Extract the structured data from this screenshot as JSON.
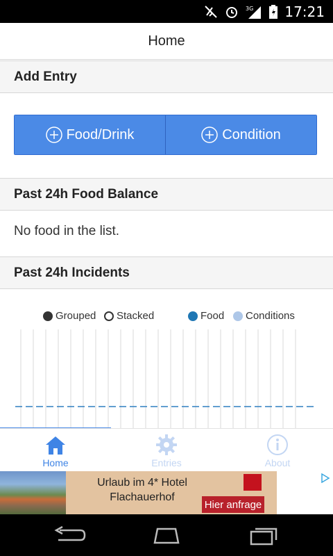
{
  "status_bar": {
    "time": "17:21",
    "network": "3G"
  },
  "header": {
    "title": "Home"
  },
  "sections": {
    "add_entry": {
      "title": "Add Entry"
    },
    "food_balance": {
      "title": "Past 24h Food Balance",
      "empty_text": "No food in the list."
    },
    "incidents": {
      "title": "Past 24h Incidents"
    }
  },
  "buttons": {
    "food_drink": "Food/Drink",
    "condition": "Condition"
  },
  "chart_legend": {
    "grouped": "Grouped",
    "stacked": "Stacked",
    "food": "Food",
    "conditions": "Conditions",
    "colors": {
      "grouped": "#333333",
      "food": "#1f77b4",
      "conditions": "#aec7e8"
    }
  },
  "chart_data": {
    "type": "bar",
    "mode": "grouped",
    "series": [
      {
        "name": "Food",
        "values": []
      },
      {
        "name": "Conditions",
        "values": []
      }
    ],
    "grid": true
  },
  "tabs": [
    {
      "label": "Home",
      "icon": "home-icon",
      "active": true
    },
    {
      "label": "Entries",
      "icon": "gear-icon",
      "active": false
    },
    {
      "label": "About",
      "icon": "info-icon",
      "active": false
    }
  ],
  "ad": {
    "headline_1": "Urlaub im 4* Hotel",
    "headline_2": "Flachauerhof",
    "cta": "Hier anfrage"
  },
  "colors": {
    "accent": "#4b8ae6",
    "tab_inactive": "#c3d6f3"
  }
}
